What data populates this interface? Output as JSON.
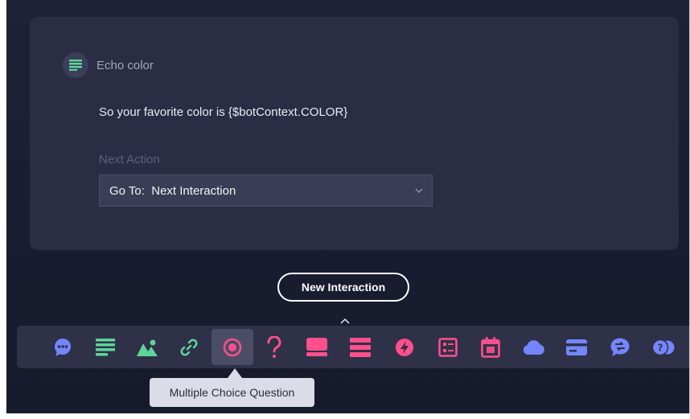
{
  "card": {
    "title": "Echo color",
    "message": "So your favorite color is {$botContext.COLOR}",
    "next_action_label": "Next Action",
    "next_action_value": "Go To:  Next Interaction"
  },
  "new_interaction_label": "New Interaction",
  "tooltip": "Multiple Choice Question",
  "toolbar_icons": [
    "chat-bubble-icon",
    "text-lines-icon",
    "image-icon",
    "link-icon",
    "radio-button-icon",
    "question-mark-icon",
    "card-icon",
    "list-icon",
    "lightning-icon",
    "form-icon",
    "calendar-icon",
    "cloud-icon",
    "credit-card-icon",
    "transfer-chat-icon",
    "questions-icon"
  ],
  "colors": {
    "background": "#1c1f33",
    "card": "#2a2d44",
    "green": "#5ed49a",
    "pink": "#ff4f8d",
    "blue": "#7486ff"
  }
}
